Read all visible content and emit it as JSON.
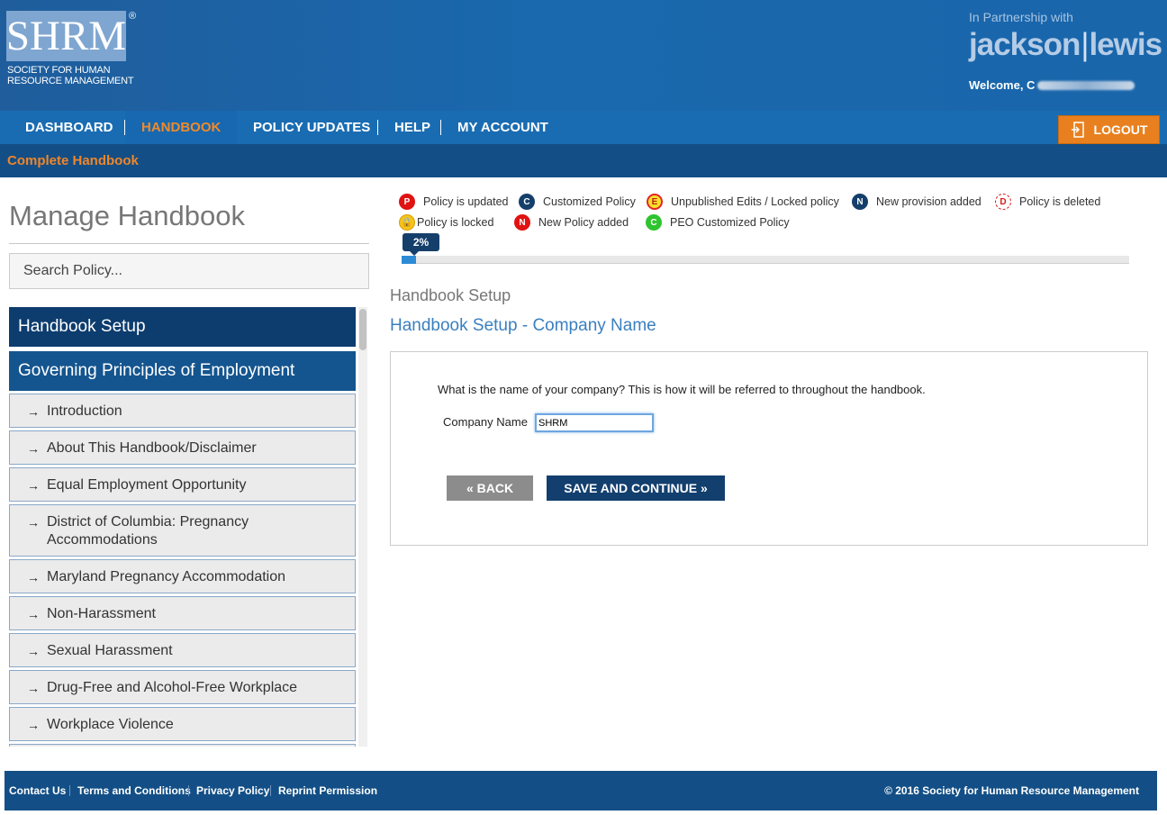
{
  "header": {
    "logo_text": "SHRM",
    "logo_registered": "®",
    "logo_sub_line1": "SOCIETY FOR HUMAN",
    "logo_sub_line2": "RESOURCE MANAGEMENT",
    "partner_text": "In Partnership with",
    "partner_name_1": "jackson",
    "partner_bar": "|",
    "partner_name_2": "lewis",
    "welcome": "Welcome, C"
  },
  "nav": {
    "items": [
      {
        "label": "DASHBOARD"
      },
      {
        "label": "HANDBOOK"
      },
      {
        "label": "POLICY UPDATES"
      },
      {
        "label": "HELP"
      },
      {
        "label": "MY ACCOUNT"
      }
    ],
    "logout_label": "LOGOUT",
    "sub_item": "Complete Handbook"
  },
  "sidebar": {
    "title": "Manage Handbook",
    "search_placeholder": "Search Policy...",
    "sections": [
      {
        "label": "Handbook Setup"
      },
      {
        "label": "Governing Principles of Employment"
      }
    ],
    "items": [
      {
        "label": "Introduction"
      },
      {
        "label": "About This Handbook/Disclaimer"
      },
      {
        "label": "Equal Employment Opportunity"
      },
      {
        "label": "District of Columbia: Pregnancy Accommodations"
      },
      {
        "label": "Maryland Pregnancy Accommodation"
      },
      {
        "label": "Non-Harassment"
      },
      {
        "label": "Sexual Harassment"
      },
      {
        "label": "Drug-Free and Alcohol-Free Workplace"
      },
      {
        "label": "Workplace Violence"
      }
    ],
    "arrow": "→"
  },
  "legend": [
    {
      "badge": "P",
      "label": "Policy is updated"
    },
    {
      "badge": "C",
      "label": "Customized Policy"
    },
    {
      "badge": "E",
      "label": "Unpublished Edits / Locked policy"
    },
    {
      "badge": "N",
      "label": "New provision added"
    },
    {
      "badge": "D",
      "label": "Policy is deleted"
    },
    {
      "badge": "🔒",
      "label": "Policy is locked"
    },
    {
      "badge": "N",
      "label": "New Policy added"
    },
    {
      "badge": "C",
      "label": "PEO Customized Policy"
    }
  ],
  "progress": {
    "value": 2,
    "label": "2%"
  },
  "main": {
    "breadcrumb": "Handbook Setup",
    "section_title": "Handbook Setup - Company Name",
    "question": "What is the name of your company? This is how it will be referred to throughout the handbook.",
    "field_label": "Company Name",
    "field_value": "SHRM",
    "back_label": "« BACK",
    "save_label": "SAVE AND CONTINUE »"
  },
  "footer": {
    "links": [
      {
        "label": "Contact Us"
      },
      {
        "label": "Terms and Conditions"
      },
      {
        "label": "Privacy Policy"
      },
      {
        "label": "Reprint Permission"
      }
    ],
    "copyright": "© 2016 Society for Human Resource Management"
  },
  "colors": {
    "header_blue": "#1a68ad",
    "nav_blue": "#1a6cb2",
    "subnav_blue": "#134f86",
    "accent_orange": "#f08a2b",
    "navy": "#0d3c6e",
    "link_blue": "#3a7fbf"
  }
}
